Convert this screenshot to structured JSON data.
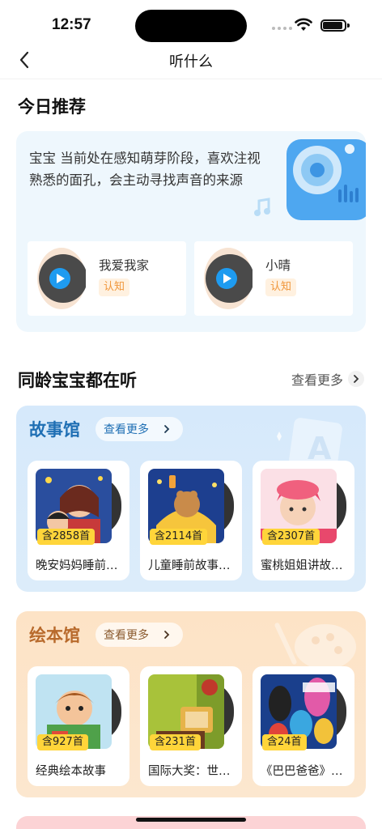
{
  "status_bar": {
    "time": "12:57"
  },
  "nav": {
    "title": "听什么"
  },
  "today": {
    "section_title": "今日推荐",
    "description": "宝宝 当前处在感知萌芽阶段，喜欢注视熟悉的面孔，会主动寻找声音的来源",
    "items": [
      {
        "name": "我爱我家",
        "tag": "认知"
      },
      {
        "name": "小晴",
        "tag": "认知"
      }
    ]
  },
  "peers": {
    "section_title": "同龄宝宝都在听",
    "see_more": "查看更多"
  },
  "story_hall": {
    "title": "故事馆",
    "see_more": "查看更多",
    "title_color": "#1f6fb4",
    "albums": [
      {
        "count": "含2858首",
        "title": "晚安妈妈睡前…"
      },
      {
        "count": "含2114首",
        "title": "儿童睡前故事…"
      },
      {
        "count": "含2307首",
        "title": "蜜桃姐姐讲故…"
      }
    ]
  },
  "picture_book_hall": {
    "title": "绘本馆",
    "see_more": "查看更多",
    "title_color": "#b86a2c",
    "albums": [
      {
        "count": "含927首",
        "title": "经典绘本故事"
      },
      {
        "count": "含231首",
        "title": "国际大奖：世…"
      },
      {
        "count": "含24首",
        "title": "《巴巴爸爸》…"
      }
    ]
  },
  "colors": {
    "tag_bg": "#fff1e0",
    "tag_text": "#f0963a",
    "play_blue": "#1e9bf0",
    "count_badge": "#ffd53a"
  }
}
